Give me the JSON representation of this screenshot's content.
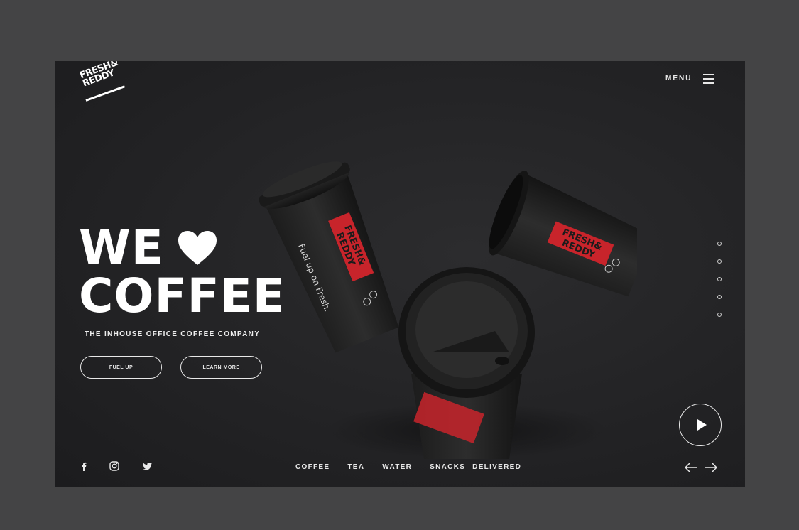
{
  "brand": {
    "logo_text": "FRESH& REDDY"
  },
  "header": {
    "menu_label": "MENU"
  },
  "hero": {
    "headline_line1": "WE",
    "headline_line2": "COFFEE",
    "tagline": "THE INHOUSE OFFICE COFFEE COMPANY",
    "primary_button": "FUEL UP",
    "secondary_button": "LEARN MORE"
  },
  "cups": {
    "brand_text": "FRESH& REDDY",
    "slogan": "Fuel up on Fresh."
  },
  "bottom_nav": [
    "COFFEE",
    "TEA",
    "WATER",
    "SNACKS",
    "DELIVERED"
  ],
  "social": [
    "facebook-icon",
    "instagram-icon",
    "twitter-icon"
  ],
  "colors": {
    "background": "#444445",
    "panel": "#232325",
    "accent": "#c8242b",
    "text": "#ffffff"
  }
}
